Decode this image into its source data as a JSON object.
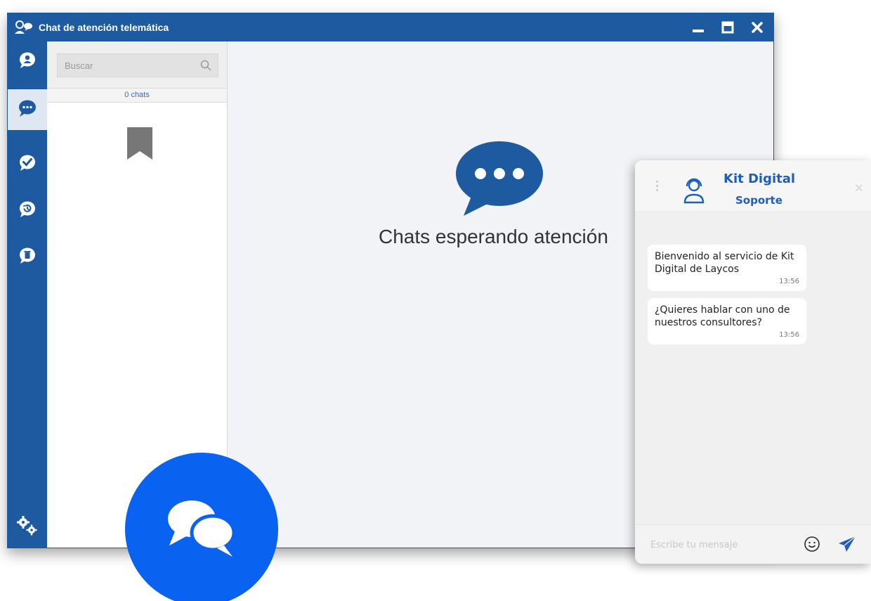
{
  "window": {
    "title": "Chat de atención telemática"
  },
  "rail": {
    "items": [
      {
        "icon": "user-bubble-icon"
      },
      {
        "icon": "chat-dots-icon",
        "active": true
      },
      {
        "icon": "check-bubble-icon"
      },
      {
        "icon": "history-bubble-icon"
      },
      {
        "icon": "trash-bubble-icon"
      }
    ],
    "settings_icon": "gears-icon"
  },
  "list": {
    "search_placeholder": "Buscar",
    "count_label": "0 chats"
  },
  "main": {
    "empty_text": "Chats esperando atención"
  },
  "widget": {
    "title": "Kit Digital",
    "subtitle": "Soporte",
    "messages": [
      {
        "text": "Bienvenido al servicio de Kit Digital de Laycos",
        "time": "13:56"
      },
      {
        "text": "¿Quieres hablar con uno de nuestros consultores?",
        "time": "13:56"
      }
    ],
    "input_placeholder": "Escribe tu mensaje"
  },
  "colors": {
    "primary": "#1d5aa0",
    "fab": "#0a63f0",
    "widget_accent": "#1f5fb8"
  }
}
